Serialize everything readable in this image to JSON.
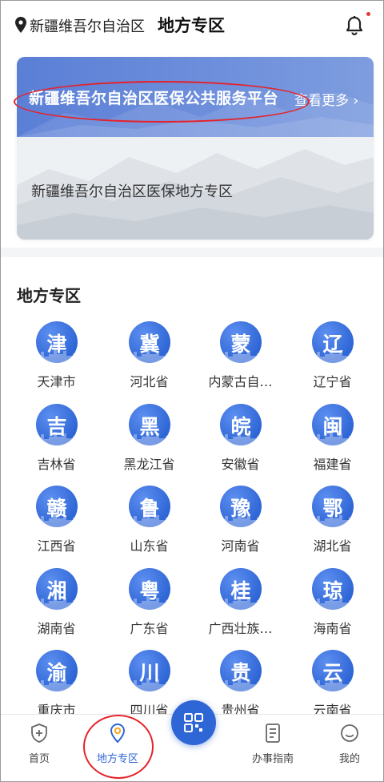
{
  "header": {
    "region": "新疆维吾尔自治区",
    "title": "地方专区"
  },
  "banner": {
    "platform_title": "新疆维吾尔自治区医保公共服务平台",
    "view_more": "查看更多 ›",
    "subzone_title": "新疆维吾尔自治区医保地方专区"
  },
  "section": {
    "title": "地方专区"
  },
  "provinces": [
    {
      "abbr": "津",
      "name": "天津市"
    },
    {
      "abbr": "冀",
      "name": "河北省"
    },
    {
      "abbr": "蒙",
      "name": "内蒙古自…"
    },
    {
      "abbr": "辽",
      "name": "辽宁省"
    },
    {
      "abbr": "吉",
      "name": "吉林省"
    },
    {
      "abbr": "黑",
      "name": "黑龙江省"
    },
    {
      "abbr": "皖",
      "name": "安徽省"
    },
    {
      "abbr": "闽",
      "name": "福建省"
    },
    {
      "abbr": "赣",
      "name": "江西省"
    },
    {
      "abbr": "鲁",
      "name": "山东省"
    },
    {
      "abbr": "豫",
      "name": "河南省"
    },
    {
      "abbr": "鄂",
      "name": "湖北省"
    },
    {
      "abbr": "湘",
      "name": "湖南省"
    },
    {
      "abbr": "粤",
      "name": "广东省"
    },
    {
      "abbr": "桂",
      "name": "广西壮族…"
    },
    {
      "abbr": "琼",
      "name": "海南省"
    },
    {
      "abbr": "渝",
      "name": "重庆市"
    },
    {
      "abbr": "川",
      "name": "四川省"
    },
    {
      "abbr": "贵",
      "name": "贵州省"
    },
    {
      "abbr": "云",
      "name": "云南省"
    }
  ],
  "tabbar": {
    "home": "首页",
    "local": "地方专区",
    "guide": "办事指南",
    "mine": "我的"
  },
  "colors": {
    "accent": "#2f66d6",
    "annotation": "#e5222a",
    "notification_dot": "#e53935"
  },
  "icons": {
    "location": "map-pin-icon",
    "notification": "bell-icon",
    "home": "shield-plus-icon",
    "local": "location-pin-icon",
    "scan": "qr-scan-icon",
    "guide": "document-icon",
    "mine": "smiley-face-icon"
  }
}
